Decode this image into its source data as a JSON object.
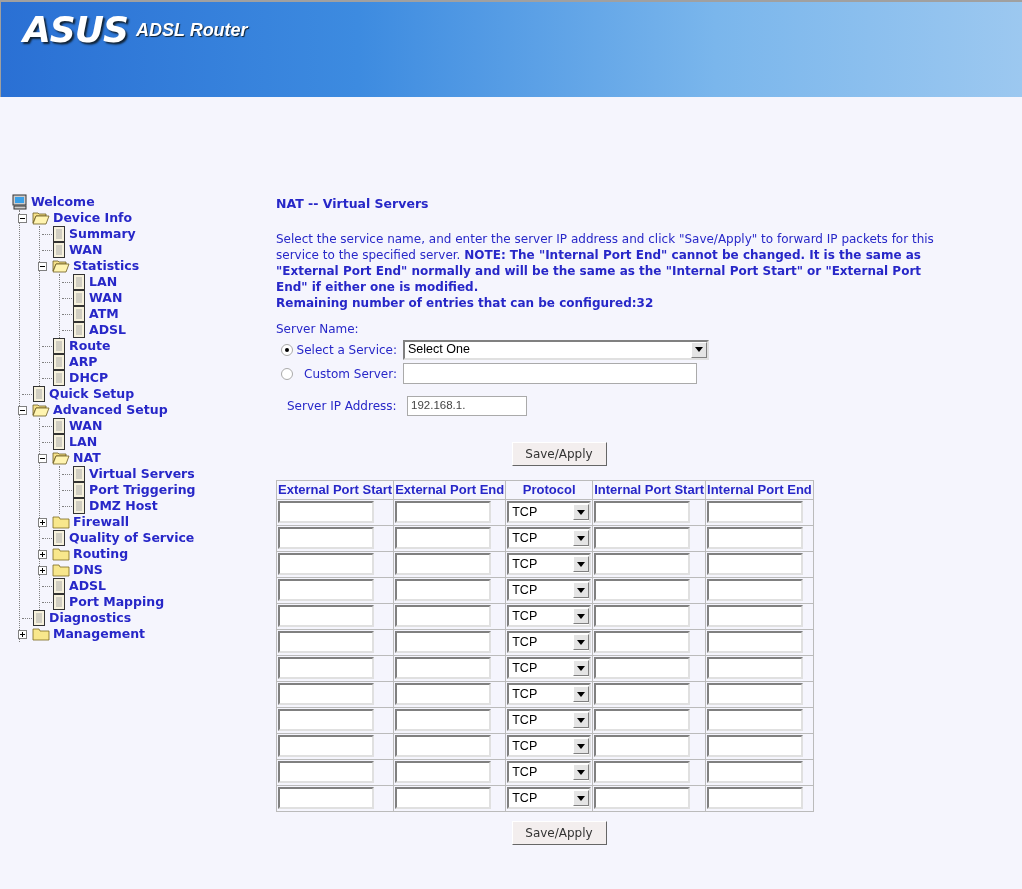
{
  "header": {
    "logo": "ASUS",
    "product": "ADSL Router"
  },
  "tree": [
    {
      "label": "Welcome",
      "kind": "computer",
      "children": [
        {
          "label": "Device Info",
          "kind": "folder",
          "expanded": true,
          "children": [
            {
              "label": "Summary",
              "kind": "page"
            },
            {
              "label": "WAN",
              "kind": "page"
            },
            {
              "label": "Statistics",
              "kind": "folder",
              "expanded": true,
              "children": [
                {
                  "label": "LAN",
                  "kind": "page"
                },
                {
                  "label": "WAN",
                  "kind": "page"
                },
                {
                  "label": "ATM",
                  "kind": "page"
                },
                {
                  "label": "ADSL",
                  "kind": "page"
                }
              ]
            },
            {
              "label": "Route",
              "kind": "page"
            },
            {
              "label": "ARP",
              "kind": "page"
            },
            {
              "label": "DHCP",
              "kind": "page"
            }
          ]
        },
        {
          "label": "Quick Setup",
          "kind": "page"
        },
        {
          "label": "Advanced Setup",
          "kind": "folder",
          "expanded": true,
          "children": [
            {
              "label": "WAN",
              "kind": "page"
            },
            {
              "label": "LAN",
              "kind": "page"
            },
            {
              "label": "NAT",
              "kind": "folder",
              "expanded": true,
              "children": [
                {
                  "label": "Virtual Servers",
                  "kind": "page"
                },
                {
                  "label": "Port Triggering",
                  "kind": "page"
                },
                {
                  "label": "DMZ Host",
                  "kind": "page"
                }
              ]
            },
            {
              "label": "Firewall",
              "kind": "folder",
              "expanded": false
            },
            {
              "label": "Quality of Service",
              "kind": "page"
            },
            {
              "label": "Routing",
              "kind": "folder",
              "expanded": false
            },
            {
              "label": "DNS",
              "kind": "folder",
              "expanded": false
            },
            {
              "label": "ADSL",
              "kind": "page"
            },
            {
              "label": "Port Mapping",
              "kind": "page"
            }
          ]
        },
        {
          "label": "Diagnostics",
          "kind": "page"
        },
        {
          "label": "Management",
          "kind": "folder",
          "expanded": false
        }
      ]
    }
  ],
  "page_title": "NAT -- Virtual Servers",
  "description": "Select the service name, and enter the server IP address and click \"Save/Apply\" to forward IP packets for this service to the specified server. **NOTE: The \"Internal Port End\" cannot be changed. It is the same as \"External Port End\" normally and will be the same as the \"Internal Port Start\" or \"External Port End\" if either one is modified.**",
  "remaining": "Remaining number of entries that can be configured:32",
  "server_name_label": "Server Name:",
  "server_options": [
    {
      "label": "Select a Service:",
      "kind": "select",
      "value": "Select One",
      "selected": true
    },
    {
      "label": "Custom Server:",
      "kind": "text",
      "selected": false
    }
  ],
  "server_ip": {
    "label": "Server IP Address:",
    "value": "192.168.1."
  },
  "save_button": "Save/Apply",
  "table": {
    "columns": [
      "External Port Start",
      "External Port End",
      "Protocol",
      "Internal Port Start",
      "Internal Port End"
    ],
    "rows": [
      {
        "protocol": "TCP"
      },
      {
        "protocol": "TCP"
      },
      {
        "protocol": "TCP"
      },
      {
        "protocol": "TCP"
      },
      {
        "protocol": "TCP"
      },
      {
        "protocol": "TCP"
      },
      {
        "protocol": "TCP"
      },
      {
        "protocol": "TCP"
      },
      {
        "protocol": "TCP"
      },
      {
        "protocol": "TCP"
      },
      {
        "protocol": "TCP"
      },
      {
        "protocol": "TCP"
      }
    ]
  },
  "save_button_bottom": "Save/Apply"
}
